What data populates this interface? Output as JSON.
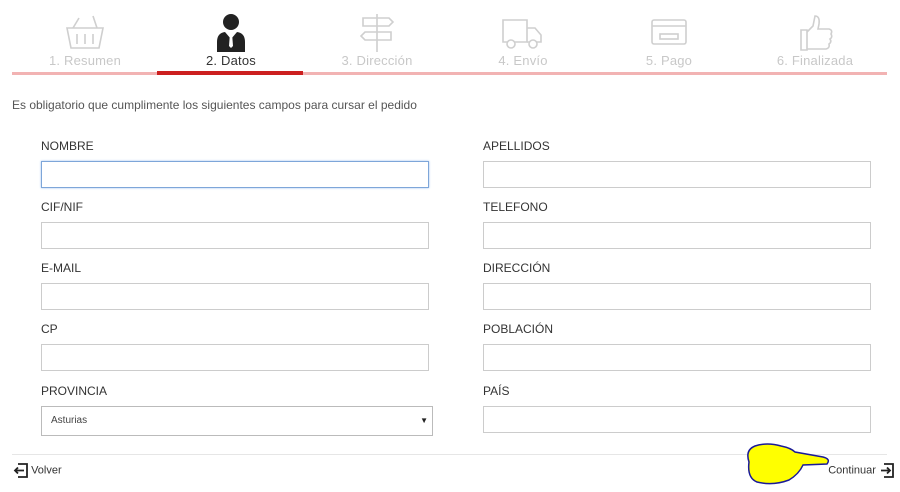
{
  "steps": [
    {
      "label": "1. Resumen",
      "icon": "basket-icon"
    },
    {
      "label": "2. Datos",
      "icon": "user-icon"
    },
    {
      "label": "3. Dirección",
      "icon": "signpost-icon"
    },
    {
      "label": "4. Envío",
      "icon": "truck-icon"
    },
    {
      "label": "5. Pago",
      "icon": "credit-card-icon"
    },
    {
      "label": "6. Finalizada",
      "icon": "thumbs-up-icon"
    }
  ],
  "intro": "Es obligatorio que cumplimente los siguientes campos para cursar el pedido",
  "form": {
    "nombre": "NOMBRE",
    "apellidos": "APELLIDOS",
    "cif": "CIF/NIF",
    "telefono": "TELEFONO",
    "email": "E-MAIL",
    "direccion": "DIRECCIÓN",
    "cp": "CP",
    "poblacion": "POBLACIÓN",
    "provincia": "PROVINCIA",
    "provincia_value": "Asturias",
    "pais": "PAÍS"
  },
  "nav": {
    "back": "Volver",
    "next": "Continuar"
  },
  "colors": {
    "accent": "#cc1f1f",
    "accent_light": "#f2b3b3",
    "pointer": "#ffff00"
  }
}
